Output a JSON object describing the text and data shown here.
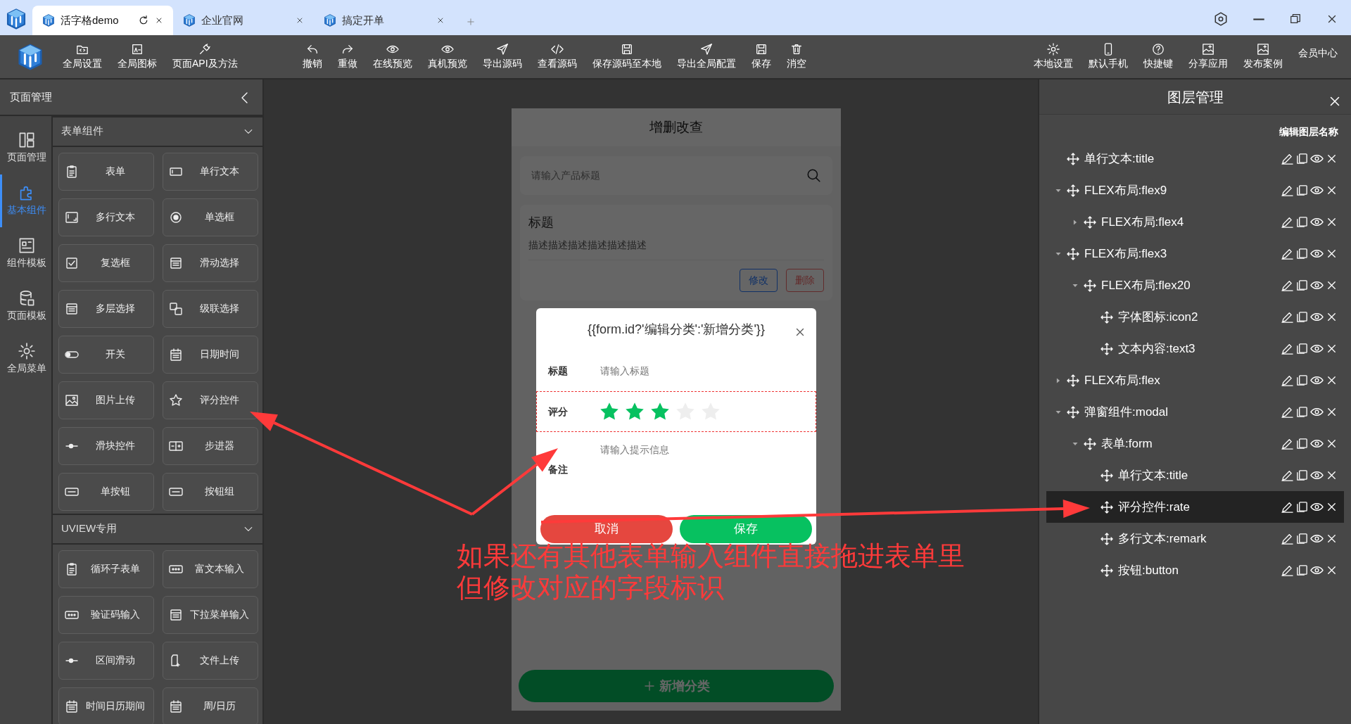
{
  "browser_tabs": [
    {
      "label": "活字格demo",
      "selected": true
    },
    {
      "label": "企业官网",
      "selected": false
    },
    {
      "label": "搞定开单",
      "selected": false
    }
  ],
  "toolbar": {
    "left": [
      "全局设置",
      "全局图标",
      "页面API及方法"
    ],
    "center": [
      "撤销",
      "重做",
      "在线预览",
      "真机预览",
      "导出源码",
      "查看源码",
      "保存源码至本地",
      "导出全局配置",
      "保存",
      "消空"
    ],
    "right": [
      "本地设置",
      "默认手机",
      "快捷键",
      "分享应用",
      "发布案例"
    ],
    "member": "会员中心"
  },
  "left_panel": {
    "title": "页面管理",
    "rail": [
      {
        "label": "页面管理",
        "selected": false
      },
      {
        "label": "基本组件",
        "selected": true
      },
      {
        "label": "组件模板",
        "selected": false
      },
      {
        "label": "页面模板",
        "selected": false
      },
      {
        "label": "全局菜单",
        "selected": false
      }
    ],
    "sections": [
      {
        "title": "表单组件",
        "expanded": true,
        "items": [
          "表单",
          "单行文本",
          "多行文本",
          "单选框",
          "复选框",
          "滑动选择",
          "多层选择",
          "级联选择",
          "开关",
          "日期时间",
          "图片上传",
          "评分控件",
          "滑块控件",
          "步进器",
          "单按钮",
          "按钮组"
        ]
      },
      {
        "title": "UVIEW专用",
        "expanded": true,
        "items": [
          "循环子表单",
          "富文本输入",
          "验证码输入",
          "下拉菜单输入",
          "区间滑动",
          "文件上传",
          "时间日历期间",
          "周/日历"
        ]
      }
    ]
  },
  "phone": {
    "title": "增删改查",
    "search": {
      "placeholder": "请输入产品标题"
    },
    "card": {
      "title": "标题",
      "description": "描述描述描述描述描述描述",
      "buttons": [
        "修改",
        "删除"
      ]
    },
    "add_button": "新增分类"
  },
  "modal": {
    "title": "{{form.id?'编辑分类':'新增分类'}}",
    "fields": [
      {
        "kind": "input",
        "label": "标题",
        "placeholder": "请输入标题",
        "selected": false
      },
      {
        "kind": "rate",
        "label": "评分",
        "stars": 3,
        "selected": true
      },
      {
        "kind": "textarea",
        "label": "备注",
        "placeholder": "请输入提示信息",
        "selected": false
      }
    ],
    "buttons": {
      "cancel": "取消",
      "save": "保存"
    }
  },
  "layers": {
    "title": "图层管理",
    "edit_label": "编辑图层名称",
    "items": [
      {
        "label": "单行文本:title",
        "selected": false
      },
      {
        "label": "FLEX布局:flex9",
        "selected": false,
        "expanded": true,
        "children": [
          {
            "label": "FLEX布局:flex4",
            "selected": false,
            "expanded": false
          }
        ]
      },
      {
        "label": "FLEX布局:flex3",
        "selected": false,
        "expanded": true,
        "children": [
          {
            "label": "FLEX布局:flex20",
            "selected": false,
            "expanded": true,
            "children": [
              {
                "label": "字体图标:icon2",
                "selected": false
              },
              {
                "label": "文本内容:text3",
                "selected": false
              }
            ]
          }
        ]
      },
      {
        "label": "FLEX布局:flex",
        "selected": false,
        "expanded": false
      },
      {
        "label": "弹窗组件:modal",
        "selected": false,
        "expanded": true,
        "children": [
          {
            "label": "表单:form",
            "selected": false,
            "expanded": true,
            "children": [
              {
                "label": "单行文本:title",
                "selected": false
              },
              {
                "label": "评分控件:rate",
                "selected": true
              },
              {
                "label": "多行文本:remark",
                "selected": false
              },
              {
                "label": "按钮:button",
                "selected": false
              }
            ]
          }
        ]
      }
    ]
  },
  "annotation": {
    "lines": [
      "如果还有其他表单输入组件直接拖进表单里",
      "但修改对应的字段标识"
    ]
  }
}
